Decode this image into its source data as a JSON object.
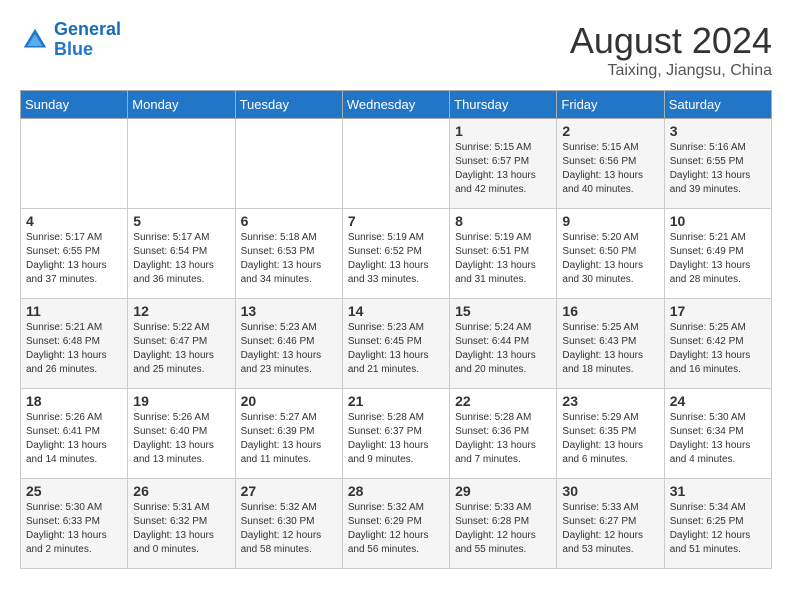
{
  "logo": {
    "line1": "General",
    "line2": "Blue"
  },
  "title": "August 2024",
  "subtitle": "Taixing, Jiangsu, China",
  "days_of_week": [
    "Sunday",
    "Monday",
    "Tuesday",
    "Wednesday",
    "Thursday",
    "Friday",
    "Saturday"
  ],
  "weeks": [
    [
      {
        "day": "",
        "info": ""
      },
      {
        "day": "",
        "info": ""
      },
      {
        "day": "",
        "info": ""
      },
      {
        "day": "",
        "info": ""
      },
      {
        "day": "1",
        "info": "Sunrise: 5:15 AM\nSunset: 6:57 PM\nDaylight: 13 hours\nand 42 minutes."
      },
      {
        "day": "2",
        "info": "Sunrise: 5:15 AM\nSunset: 6:56 PM\nDaylight: 13 hours\nand 40 minutes."
      },
      {
        "day": "3",
        "info": "Sunrise: 5:16 AM\nSunset: 6:55 PM\nDaylight: 13 hours\nand 39 minutes."
      }
    ],
    [
      {
        "day": "4",
        "info": "Sunrise: 5:17 AM\nSunset: 6:55 PM\nDaylight: 13 hours\nand 37 minutes."
      },
      {
        "day": "5",
        "info": "Sunrise: 5:17 AM\nSunset: 6:54 PM\nDaylight: 13 hours\nand 36 minutes."
      },
      {
        "day": "6",
        "info": "Sunrise: 5:18 AM\nSunset: 6:53 PM\nDaylight: 13 hours\nand 34 minutes."
      },
      {
        "day": "7",
        "info": "Sunrise: 5:19 AM\nSunset: 6:52 PM\nDaylight: 13 hours\nand 33 minutes."
      },
      {
        "day": "8",
        "info": "Sunrise: 5:19 AM\nSunset: 6:51 PM\nDaylight: 13 hours\nand 31 minutes."
      },
      {
        "day": "9",
        "info": "Sunrise: 5:20 AM\nSunset: 6:50 PM\nDaylight: 13 hours\nand 30 minutes."
      },
      {
        "day": "10",
        "info": "Sunrise: 5:21 AM\nSunset: 6:49 PM\nDaylight: 13 hours\nand 28 minutes."
      }
    ],
    [
      {
        "day": "11",
        "info": "Sunrise: 5:21 AM\nSunset: 6:48 PM\nDaylight: 13 hours\nand 26 minutes."
      },
      {
        "day": "12",
        "info": "Sunrise: 5:22 AM\nSunset: 6:47 PM\nDaylight: 13 hours\nand 25 minutes."
      },
      {
        "day": "13",
        "info": "Sunrise: 5:23 AM\nSunset: 6:46 PM\nDaylight: 13 hours\nand 23 minutes."
      },
      {
        "day": "14",
        "info": "Sunrise: 5:23 AM\nSunset: 6:45 PM\nDaylight: 13 hours\nand 21 minutes."
      },
      {
        "day": "15",
        "info": "Sunrise: 5:24 AM\nSunset: 6:44 PM\nDaylight: 13 hours\nand 20 minutes."
      },
      {
        "day": "16",
        "info": "Sunrise: 5:25 AM\nSunset: 6:43 PM\nDaylight: 13 hours\nand 18 minutes."
      },
      {
        "day": "17",
        "info": "Sunrise: 5:25 AM\nSunset: 6:42 PM\nDaylight: 13 hours\nand 16 minutes."
      }
    ],
    [
      {
        "day": "18",
        "info": "Sunrise: 5:26 AM\nSunset: 6:41 PM\nDaylight: 13 hours\nand 14 minutes."
      },
      {
        "day": "19",
        "info": "Sunrise: 5:26 AM\nSunset: 6:40 PM\nDaylight: 13 hours\nand 13 minutes."
      },
      {
        "day": "20",
        "info": "Sunrise: 5:27 AM\nSunset: 6:39 PM\nDaylight: 13 hours\nand 11 minutes."
      },
      {
        "day": "21",
        "info": "Sunrise: 5:28 AM\nSunset: 6:37 PM\nDaylight: 13 hours\nand 9 minutes."
      },
      {
        "day": "22",
        "info": "Sunrise: 5:28 AM\nSunset: 6:36 PM\nDaylight: 13 hours\nand 7 minutes."
      },
      {
        "day": "23",
        "info": "Sunrise: 5:29 AM\nSunset: 6:35 PM\nDaylight: 13 hours\nand 6 minutes."
      },
      {
        "day": "24",
        "info": "Sunrise: 5:30 AM\nSunset: 6:34 PM\nDaylight: 13 hours\nand 4 minutes."
      }
    ],
    [
      {
        "day": "25",
        "info": "Sunrise: 5:30 AM\nSunset: 6:33 PM\nDaylight: 13 hours\nand 2 minutes."
      },
      {
        "day": "26",
        "info": "Sunrise: 5:31 AM\nSunset: 6:32 PM\nDaylight: 13 hours\nand 0 minutes."
      },
      {
        "day": "27",
        "info": "Sunrise: 5:32 AM\nSunset: 6:30 PM\nDaylight: 12 hours\nand 58 minutes."
      },
      {
        "day": "28",
        "info": "Sunrise: 5:32 AM\nSunset: 6:29 PM\nDaylight: 12 hours\nand 56 minutes."
      },
      {
        "day": "29",
        "info": "Sunrise: 5:33 AM\nSunset: 6:28 PM\nDaylight: 12 hours\nand 55 minutes."
      },
      {
        "day": "30",
        "info": "Sunrise: 5:33 AM\nSunset: 6:27 PM\nDaylight: 12 hours\nand 53 minutes."
      },
      {
        "day": "31",
        "info": "Sunrise: 5:34 AM\nSunset: 6:25 PM\nDaylight: 12 hours\nand 51 minutes."
      }
    ]
  ]
}
